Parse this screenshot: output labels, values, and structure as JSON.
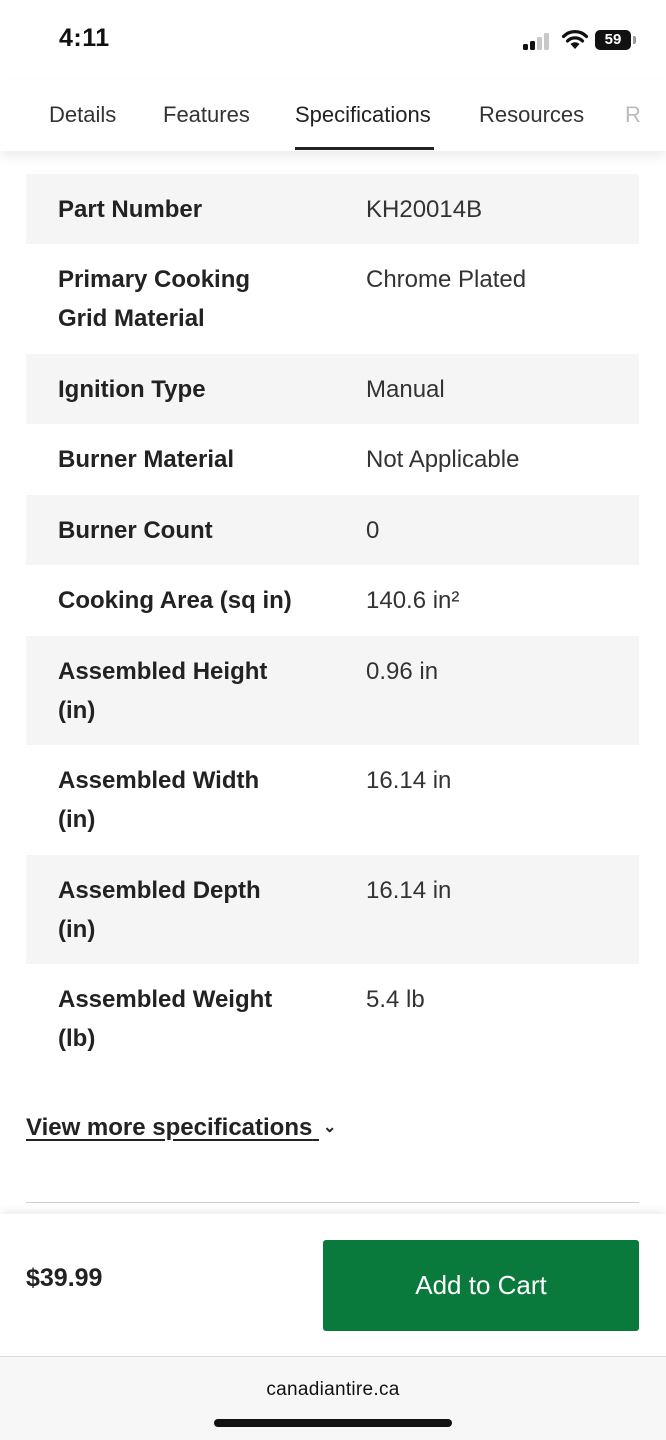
{
  "status_bar": {
    "time": "4:11",
    "battery": "59",
    "icons": [
      "signal-icon",
      "wifi-icon",
      "battery-icon"
    ]
  },
  "tabs": [
    {
      "label": "Details"
    },
    {
      "label": "Features"
    },
    {
      "label": "Specifications"
    },
    {
      "label": "Resources"
    },
    {
      "label": "R"
    }
  ],
  "specifications": [
    {
      "label": "Part Number",
      "value": "KH20014B"
    },
    {
      "label": "Primary Cooking Grid Material",
      "value": "Chrome Plated"
    },
    {
      "label": "Ignition Type",
      "value": "Manual"
    },
    {
      "label": "Burner Material",
      "value": "Not Applicable"
    },
    {
      "label": "Burner Count",
      "value": "0"
    },
    {
      "label": "Cooking Area (sq in)",
      "value": "140.6 in²"
    },
    {
      "label": "Assembled Height (in)",
      "value": "0.96 in"
    },
    {
      "label": "Assembled Width (in)",
      "value": "16.14 in"
    },
    {
      "label": "Assembled Depth (in)",
      "value": "16.14 in"
    },
    {
      "label": "Assembled Weight (lb)",
      "value": "5.4 lb"
    }
  ],
  "view_more": {
    "label": "View more specifications",
    "icon": "chevron-down-icon"
  },
  "cart": {
    "price": "$39.99",
    "add_to_cart_label": "Add to Cart",
    "button_color": "#0a7a3c"
  },
  "browser": {
    "url": "canadiantire.ca"
  }
}
